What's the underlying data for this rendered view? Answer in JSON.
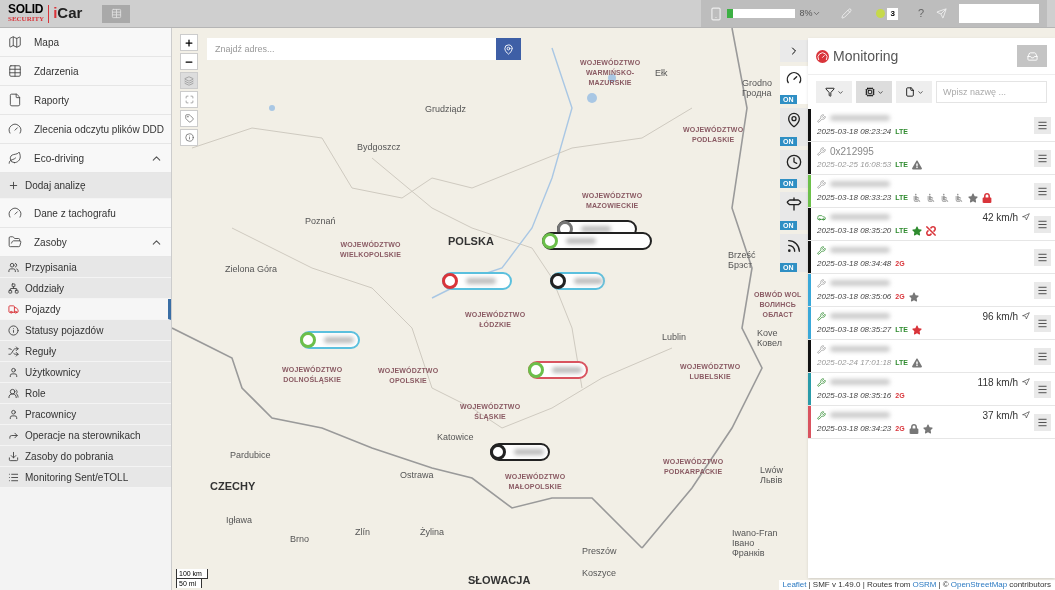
{
  "header": {
    "logo_top": "SOLID",
    "logo_bottom": "SECURITY",
    "product": "iCar",
    "progress": {
      "level": 0.08,
      "reading": "8%"
    },
    "notifications": "3",
    "help": "?"
  },
  "sidebar": {
    "items": [
      {
        "label": "Mapa",
        "selected": false
      },
      {
        "label": "Zdarzenia",
        "selected": false
      },
      {
        "label": "Raporty",
        "selected": false
      },
      {
        "label": "Zlecenia odczytu plików DDD",
        "selected": false
      },
      {
        "label": "Eco-driving",
        "selected": false,
        "expanded": true,
        "children": [
          {
            "label": "Dodaj analizę",
            "selected": false
          }
        ]
      },
      {
        "label": "Dane z tachografu",
        "selected": false
      },
      {
        "label": "Zasoby",
        "selected": false,
        "expanded": true,
        "children": [
          {
            "label": "Przypisania",
            "selected": false
          },
          {
            "label": "Oddziały",
            "selected": false
          },
          {
            "label": "Pojazdy",
            "selected": true
          },
          {
            "label": "Statusy pojazdów",
            "selected": false
          },
          {
            "label": "Reguły",
            "selected": false
          },
          {
            "label": "Użytkownicy",
            "selected": false
          },
          {
            "label": "Role",
            "selected": false
          },
          {
            "label": "Pracownicy",
            "selected": false
          },
          {
            "label": "Operacje na sterownikach",
            "selected": false
          },
          {
            "label": "Zasoby do pobrania",
            "selected": false
          },
          {
            "label": "Monitoring Sent/eTOLL",
            "selected": false
          }
        ]
      }
    ]
  },
  "map": {
    "search": {
      "placeholder": "Znajdź adres..."
    },
    "labels": [
      {
        "kind": "region",
        "text": "WOJEWÓDZTWO\nWARMIŃSKO-\nMAZURSKIE"
      },
      {
        "kind": "city",
        "text": "Ełk"
      },
      {
        "kind": "city",
        "text": "Grodno\nГродна"
      },
      {
        "kind": "city",
        "text": "Grudziądz"
      },
      {
        "kind": "region",
        "text": "WOJEWÓDZTWO\nPODLASKIE"
      },
      {
        "kind": "city",
        "text": "Bydgoszcz"
      },
      {
        "kind": "region",
        "text": "WOJEWÓDZTWO\nMAZOWIECKIE"
      },
      {
        "kind": "city",
        "text": "Poznań"
      },
      {
        "kind": "country",
        "text": "POLSKA"
      },
      {
        "kind": "region",
        "text": "WOJEWÓDZTWO\nWIELKOPOLSKIE"
      },
      {
        "kind": "city",
        "text": "Zielona Góra"
      },
      {
        "kind": "city",
        "text": "Brześć\nБрэст"
      },
      {
        "kind": "region",
        "text": "OBWÓD WOL\nВОЛИНСЬ\nОБЛАСТ"
      },
      {
        "kind": "region",
        "text": "WOJEWÓDZTWO\nŁÓDZKIE"
      },
      {
        "kind": "city",
        "text": "Kove\nКовел"
      },
      {
        "kind": "city",
        "text": "Lublin"
      },
      {
        "kind": "region",
        "text": "WOJEWÓDZTWO\nDOLNOŚLĄSKIE"
      },
      {
        "kind": "region",
        "text": "WOJEWÓDZTWO\nOPOLSKIE"
      },
      {
        "kind": "region",
        "text": "WOJEWÓDZTWO\nLUBELSKIE"
      },
      {
        "kind": "region",
        "text": "WOJEWÓDZTWO\nŚLĄSKIE"
      },
      {
        "kind": "city",
        "text": "Katowice"
      },
      {
        "kind": "city",
        "text": "Pardubice"
      },
      {
        "kind": "region",
        "text": "WOJEWÓDZTWO\nPODKARPACKIE"
      },
      {
        "kind": "city",
        "text": "Lwów\nЛьвів"
      },
      {
        "kind": "country",
        "text": "CZECHY"
      },
      {
        "kind": "city",
        "text": "Ostrawa"
      },
      {
        "kind": "region",
        "text": "WOJEWÓDZTWO\nMAŁOPOLSKIE"
      },
      {
        "kind": "city",
        "text": "Igława"
      },
      {
        "kind": "city",
        "text": "Zlín"
      },
      {
        "kind": "city",
        "text": "Żylina"
      },
      {
        "kind": "city",
        "text": "Brno"
      },
      {
        "kind": "city",
        "text": "Preszów"
      },
      {
        "kind": "city",
        "text": "Iwano-Fran\nІвано\nФранків"
      },
      {
        "kind": "country",
        "text": "SŁOWACJA"
      },
      {
        "kind": "city",
        "text": "Koszyce"
      }
    ],
    "markers": [
      {
        "color": "#222222",
        "status": {
          "color": "#777777"
        }
      },
      {
        "color": "#222222",
        "status": {
          "color": "#6cbf4a"
        }
      },
      {
        "color": "#5bc0de",
        "status": {
          "color": "#d9343a"
        }
      },
      {
        "color": "#5bc0de",
        "status": {
          "color": "#222222"
        }
      },
      {
        "color": "#5bc0de",
        "status": {
          "color": "#6cbf4a"
        }
      },
      {
        "color": "#d9535f",
        "status": {
          "color": "#6cbf4a"
        }
      },
      {
        "color": "#222222",
        "status": {
          "color": "#222222"
        }
      }
    ],
    "scale": {
      "metric": "100 km",
      "imperial": "50 mi"
    },
    "attribution": {
      "leaflet": "Leaflet",
      "version": "| SMF v 1.49.0 | Routes from",
      "osrm": "OSRM",
      "copy": "| ©",
      "osm": "OpenStreetMap",
      "contributors": "contributors"
    }
  },
  "layer_tabs": [
    {
      "badge": "ON",
      "selected": true
    },
    {
      "badge": "ON",
      "selected": false
    },
    {
      "badge": "ON",
      "selected": false
    },
    {
      "badge": "ON",
      "selected": false
    },
    {
      "badge": "ON",
      "selected": false
    }
  ],
  "monitoring": {
    "title": "Monitoring",
    "search": {
      "placeholder": "Wpisz nazwę ..."
    },
    "rows": [
      {
        "kind": "wrench",
        "color": "#111111",
        "ignition": false,
        "inactive": false,
        "date": "2025-03-18 08:23:24",
        "network": "LTE",
        "network_ok": true,
        "badges": []
      },
      {
        "kind": "wrench",
        "color": "#111111",
        "ignition": false,
        "inactive": true,
        "name": "0x212995",
        "date": "2025-02-25 16:08:53",
        "network": "LTE",
        "network_ok": true,
        "badges": [
          {
            "kind": "warning",
            "color": "#777777"
          }
        ]
      },
      {
        "kind": "wrench",
        "color": "#6cbf4a",
        "ignition": false,
        "inactive": false,
        "date": "2025-03-18 08:33:23",
        "network": "LTE",
        "network_ok": true,
        "badges": [
          {
            "kind": "seat"
          },
          {
            "kind": "seat"
          },
          {
            "kind": "seat"
          },
          {
            "kind": "seat"
          },
          {
            "kind": "star",
            "color": "#777777"
          },
          {
            "kind": "lock",
            "color": "#d9343a"
          }
        ]
      },
      {
        "kind": "car",
        "color": "#111111",
        "ignition": true,
        "inactive": false,
        "speed": "42 km/h",
        "date": "2025-03-18 08:35:20",
        "network": "LTE",
        "network_ok": true,
        "badges": [
          {
            "kind": "star",
            "color": "#2e8b2e"
          },
          {
            "kind": "unlink",
            "color": "#d9343a"
          }
        ]
      },
      {
        "kind": "wrench",
        "color": "#111111",
        "ignition": true,
        "inactive": false,
        "date": "2025-03-18 08:34:48",
        "network": "2G",
        "network_ok": false,
        "badges": []
      },
      {
        "kind": "wrench",
        "color": "#3aa8d8",
        "ignition": false,
        "inactive": false,
        "date": "2025-03-18 08:35:06",
        "network": "2G",
        "network_ok": false,
        "badges": [
          {
            "kind": "star",
            "color": "#777777"
          }
        ]
      },
      {
        "kind": "wrench",
        "color": "#3aa8d8",
        "ignition": true,
        "inactive": false,
        "speed": "96 km/h",
        "date": "2025-03-18 08:35:27",
        "network": "LTE",
        "network_ok": true,
        "badges": [
          {
            "kind": "star",
            "color": "#d9343a"
          }
        ]
      },
      {
        "kind": "wrench",
        "color": "#111111",
        "ignition": false,
        "inactive": true,
        "date": "2025-02-24 17:01:18",
        "network": "LTE",
        "network_ok": true,
        "badges": [
          {
            "kind": "warning",
            "color": "#777777"
          }
        ]
      },
      {
        "kind": "wrench",
        "color": "#2a9aa8",
        "ignition": true,
        "inactive": false,
        "speed": "118 km/h",
        "date": "2025-03-18 08:35:16",
        "network": "2G",
        "network_ok": false,
        "badges": []
      },
      {
        "kind": "wrench",
        "color": "#d9535f",
        "ignition": true,
        "inactive": false,
        "speed": "37 km/h",
        "date": "2025-03-18 08:34:23",
        "network": "2G",
        "network_ok": false,
        "badges": [
          {
            "kind": "lock",
            "color": "#777777"
          },
          {
            "kind": "star",
            "color": "#777777"
          }
        ]
      }
    ]
  }
}
